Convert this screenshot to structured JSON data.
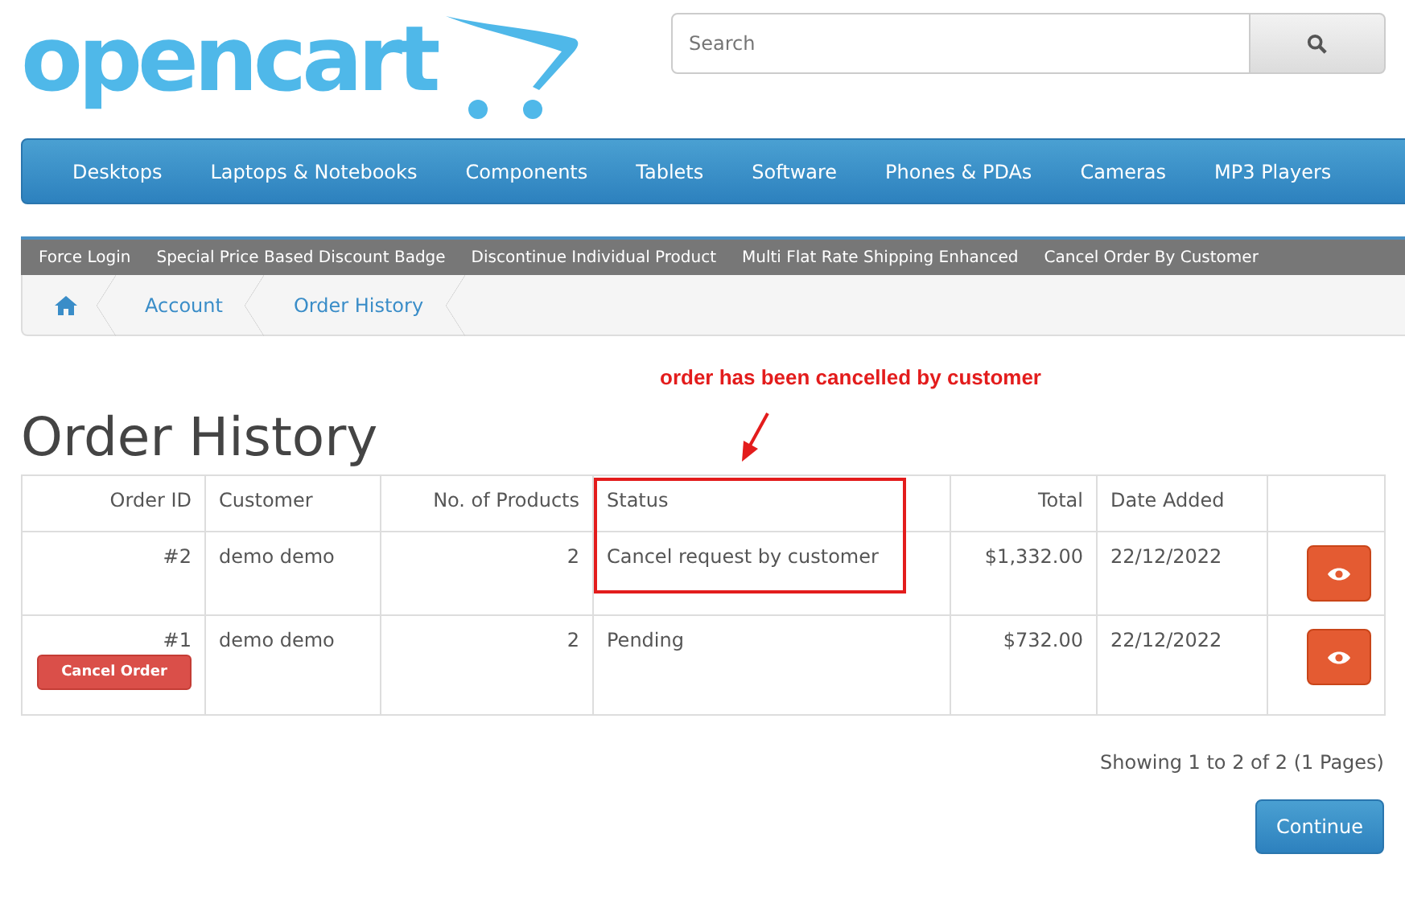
{
  "logo": {
    "text": "opencart"
  },
  "search": {
    "placeholder": "Search"
  },
  "menu": [
    "Desktops",
    "Laptops & Notebooks",
    "Components",
    "Tablets",
    "Software",
    "Phones & PDAs",
    "Cameras",
    "MP3 Players"
  ],
  "modules": [
    "Force Login",
    "Special Price Based Discount Badge",
    "Discontinue Individual Product",
    "Multi Flat Rate Shipping Enhanced",
    "Cancel Order By Customer"
  ],
  "breadcrumb": [
    "Account",
    "Order History"
  ],
  "annotation": {
    "text": "order has been cancelled by customer"
  },
  "title": "Order History",
  "table": {
    "columns": [
      "Order ID",
      "Customer",
      "No. of Products",
      "Status",
      "Total",
      "Date Added"
    ],
    "rows": [
      {
        "order_id": "#2",
        "customer": "demo demo",
        "products": "2",
        "status": "Cancel request by customer",
        "total": "$1,332.00",
        "date": "22/12/2022"
      },
      {
        "order_id": "#1",
        "cancel_button": "Cancel Order",
        "customer": "demo demo",
        "products": "2",
        "status": "Pending",
        "total": "$732.00",
        "date": "22/12/2022"
      }
    ]
  },
  "pagination": "Showing 1 to 2 of 2 (1 Pages)",
  "continue_button": "Continue"
}
